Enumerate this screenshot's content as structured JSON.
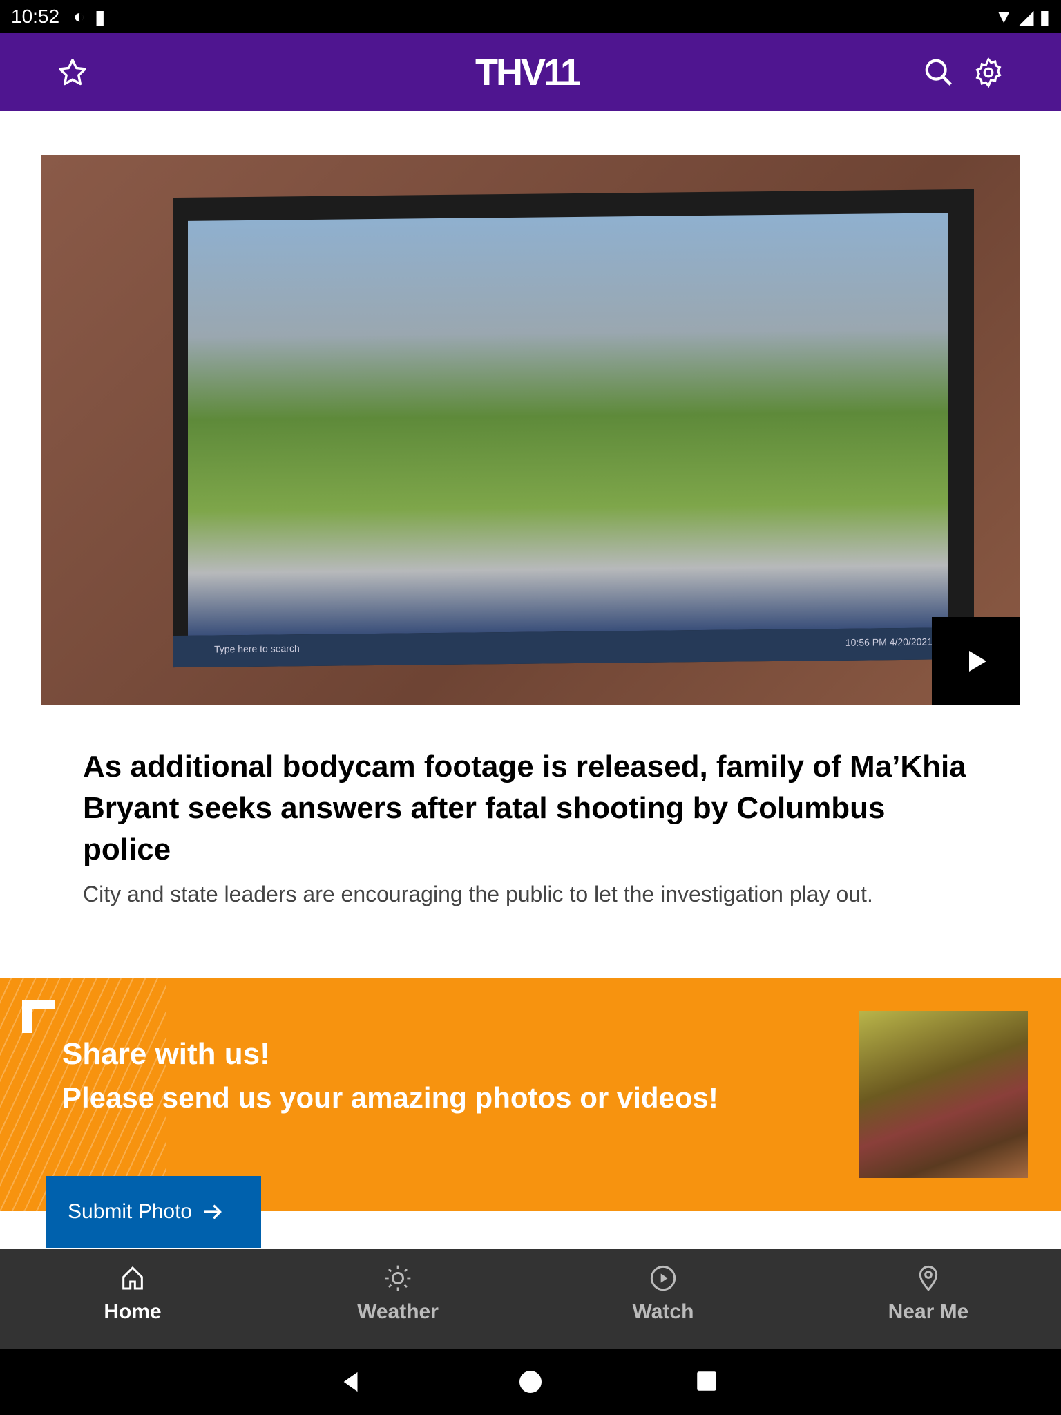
{
  "status_bar": {
    "time": "10:52"
  },
  "header": {
    "logo": "THV11",
    "colors": {
      "brand": "#4f1590"
    }
  },
  "hero": {
    "video_taskbar_search": "Type here to search",
    "video_clock": "10:56 PM",
    "video_date": "4/20/2021"
  },
  "article": {
    "headline": "As additional bodycam footage is released, family of Ma’Khia Bryant seeks answers after fatal shooting by Columbus police",
    "summary": "City and state leaders are encouraging the public to let the investigation play out."
  },
  "banner": {
    "title": "Share with us!",
    "subtitle": "Please send us your amazing photos or videos!",
    "button": "Submit Photo",
    "colors": {
      "background": "#f7930f",
      "button": "#0061ad"
    }
  },
  "bottom_nav": {
    "items": [
      {
        "label": "Home",
        "icon": "home-icon",
        "active": true
      },
      {
        "label": "Weather",
        "icon": "sun-icon",
        "active": false
      },
      {
        "label": "Watch",
        "icon": "play-circle-icon",
        "active": false
      },
      {
        "label": "Near Me",
        "icon": "location-pin-icon",
        "active": false
      }
    ]
  }
}
